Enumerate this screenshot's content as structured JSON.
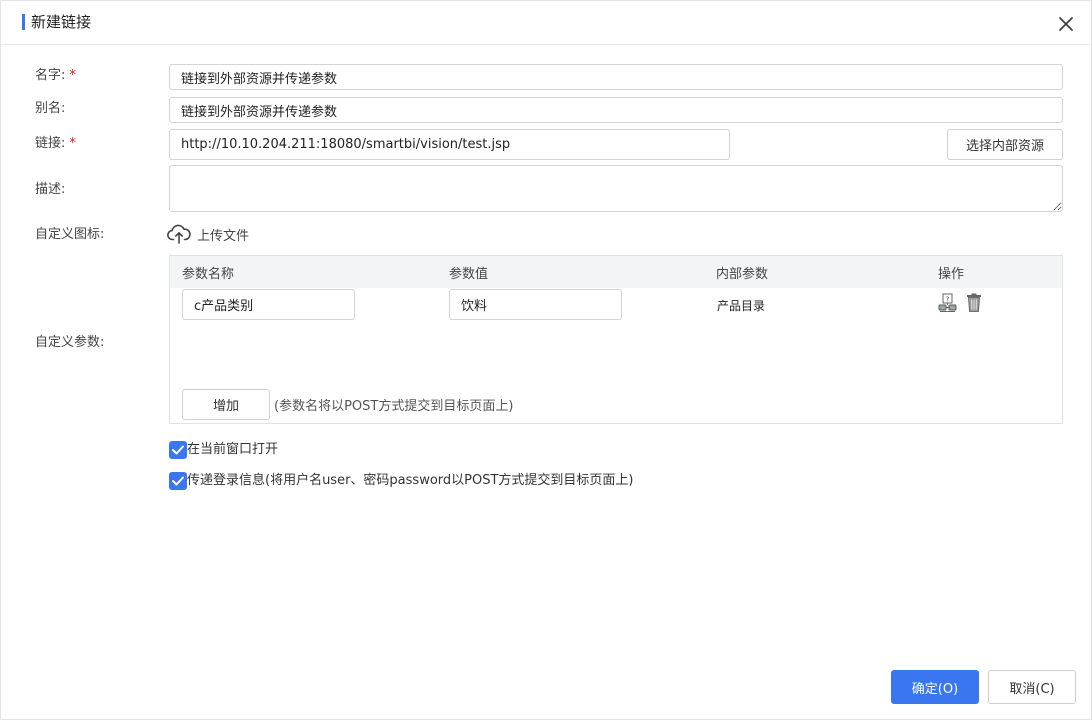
{
  "dialog": {
    "title": "新建链接",
    "accent_color": "#3a76f0",
    "close_icon": "close-icon"
  },
  "form": {
    "name": {
      "label": "名字:",
      "required_mark": "*",
      "value": "链接到外部资源并传递参数"
    },
    "alias": {
      "label": "别名:",
      "value": "链接到外部资源并传递参数"
    },
    "link": {
      "label": "链接:",
      "required_mark": "*",
      "value": "http://10.10.204.211:18080/smartbi/vision/test.jsp",
      "select_button": "选择内部资源"
    },
    "description": {
      "label": "描述:",
      "value": ""
    },
    "custom_icon": {
      "label": "自定义图标:",
      "upload_label": "上传文件",
      "icon": "cloud-upload-icon"
    },
    "custom_params": {
      "label": "自定义参数:",
      "columns": [
        "参数名称",
        "参数值",
        "内部参数",
        "操作"
      ],
      "rows": [
        {
          "name": "c产品类别",
          "value": "饮料",
          "internal": "产品目录",
          "ops": [
            "link-param-icon",
            "trash-icon"
          ]
        }
      ],
      "add_button": "增加",
      "hint": "(参数名将以POST方式提交到目标页面上)"
    },
    "open_in_current_window": {
      "label": "在当前窗口打开",
      "checked": true
    },
    "pass_login_info": {
      "label": "传递登录信息(将用户名user、密码password以POST方式提交到目标页面上)",
      "checked": true
    }
  },
  "footer": {
    "ok": "确定(O)",
    "cancel": "取消(C)"
  }
}
